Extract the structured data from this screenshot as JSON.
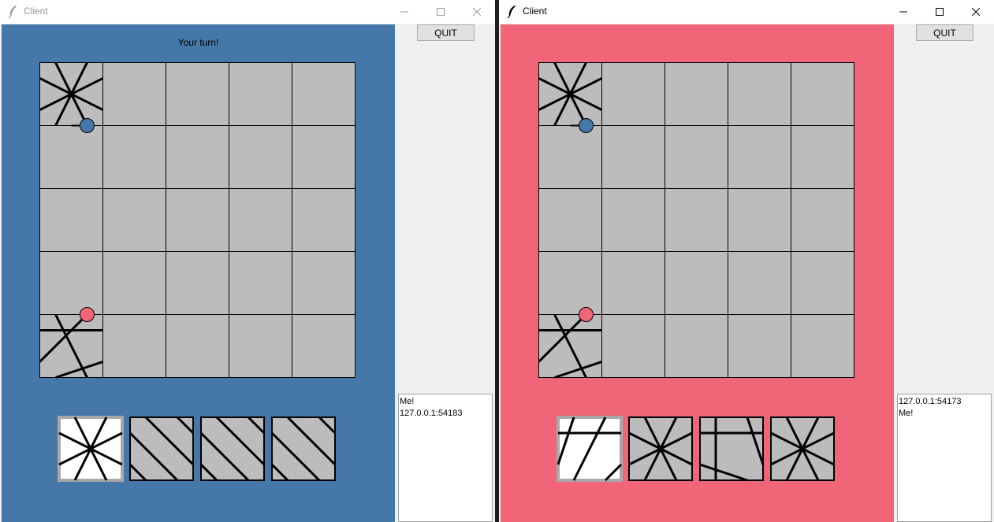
{
  "colors": {
    "left_background": "#4577a9",
    "right_background": "#f06678",
    "board_cell": "#bcbcbc",
    "player_blue": "#4577a9",
    "player_pink": "#f06678",
    "selected_tile_border": "#a8a8a8"
  },
  "left_window": {
    "title": "Client",
    "status_text": "Your turn!",
    "quit_label": "QUIT",
    "log_lines": [
      "Me!",
      "127.0.0.1:54183"
    ]
  },
  "right_window": {
    "title": "Client",
    "status_text": "",
    "quit_label": "QUIT",
    "log_lines": [
      "127.0.0.1:54173",
      "Me!"
    ]
  }
}
